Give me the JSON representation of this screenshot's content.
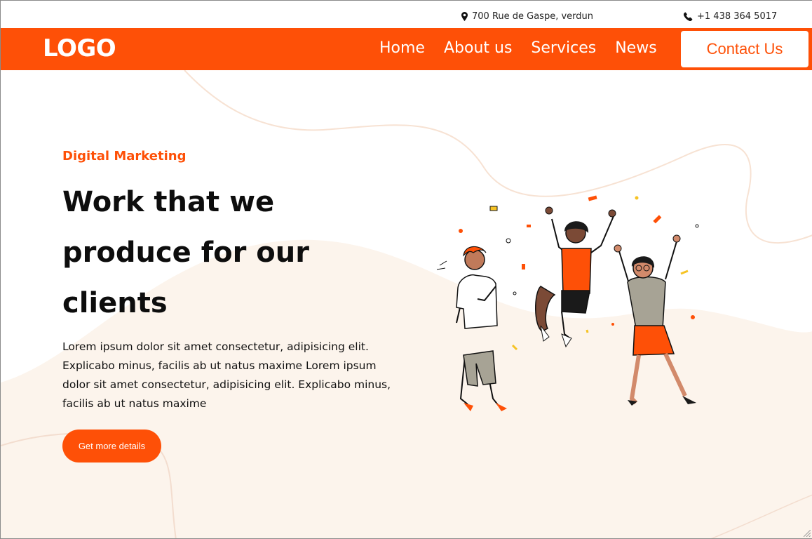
{
  "topbar": {
    "address": "700 Rue de Gaspe, verdun",
    "phone": "+1 438 364 5017",
    "address_icon": "map-pin-icon",
    "phone_icon": "phone-icon"
  },
  "navbar": {
    "logo": "LOGO",
    "links": [
      {
        "label": "Home"
      },
      {
        "label": "About us"
      },
      {
        "label": "Services"
      },
      {
        "label": "News"
      }
    ],
    "contact_label": "Contact Us"
  },
  "hero": {
    "eyebrow": "Digital Marketing",
    "headline": "Work that we produce for our clients",
    "body": "Lorem ipsum dolor sit amet consectetur, adipisicing elit. Explicabo minus, facilis ab ut natus maxime Lorem ipsum dolor sit amet consectetur, adipisicing elit. Explicabo minus, facilis ab ut natus maxime",
    "cta_label": "Get more details"
  },
  "colors": {
    "accent": "#fe5007",
    "background_wave": "#fcf4ec",
    "text": "#0d0d0d"
  }
}
